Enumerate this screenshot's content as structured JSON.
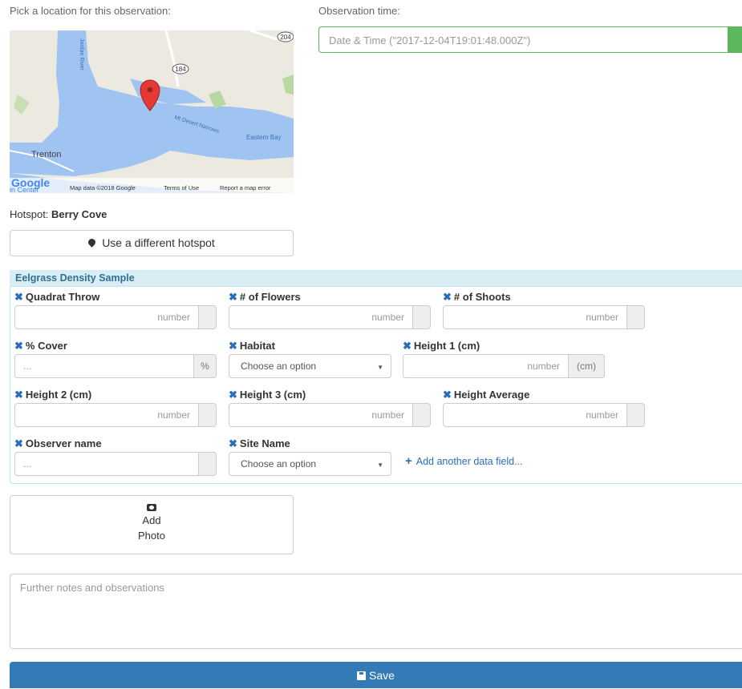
{
  "location": {
    "prompt": "Pick a location for this observation:",
    "map": {
      "roads": [
        "204",
        "184"
      ],
      "places": [
        "Trenton",
        "Eastern Bay",
        "Mt Desert Narrows",
        "Jordan River"
      ],
      "attribution": "Map data ©2018 Google",
      "terms": "Terms of Use",
      "report": "Report a map error",
      "logo": "Google",
      "corner_text": "in Center"
    }
  },
  "observation_time": {
    "label": "Observation time:",
    "placeholder": "Date & Time (\"2017-12-04T19:01:48.000Z\")"
  },
  "hotspot": {
    "prefix": "Hotspot:",
    "name": "Berry Cove",
    "change_button": "Use a different hotspot"
  },
  "sample_panel": {
    "title": "Eelgrass Density Sample",
    "fields": [
      {
        "label": "Quadrat Throw",
        "placeholder": "number",
        "addon": ""
      },
      {
        "label": "# of Flowers",
        "placeholder": "number",
        "addon": ""
      },
      {
        "label": "# of Shoots",
        "placeholder": "number",
        "addon": ""
      },
      {
        "label": "% Cover",
        "placeholder": "...",
        "addon": "%"
      },
      {
        "label": "Habitat",
        "placeholder": "Choose an option"
      },
      {
        "label": "Height 1 (cm)",
        "placeholder": "number",
        "addon": "(cm)"
      },
      {
        "label": "Height 2 (cm)",
        "placeholder": "number",
        "addon": ""
      },
      {
        "label": "Height 3 (cm)",
        "placeholder": "number",
        "addon": ""
      },
      {
        "label": "Height Average",
        "placeholder": "number",
        "addon": ""
      },
      {
        "label": "Observer name",
        "placeholder": "...",
        "addon": ""
      },
      {
        "label": "Site Name",
        "placeholder": "Choose an option"
      }
    ],
    "add_field": "Add another data field..."
  },
  "photo": {
    "line1": "Add",
    "line2": "Photo"
  },
  "notes": {
    "placeholder": "Further notes and observations"
  },
  "save": {
    "label": "Save"
  },
  "colors": {
    "primary": "#337ab7",
    "success": "#5cb85c",
    "panel_head": "#d9edf7",
    "link": "#2a6ebb"
  }
}
